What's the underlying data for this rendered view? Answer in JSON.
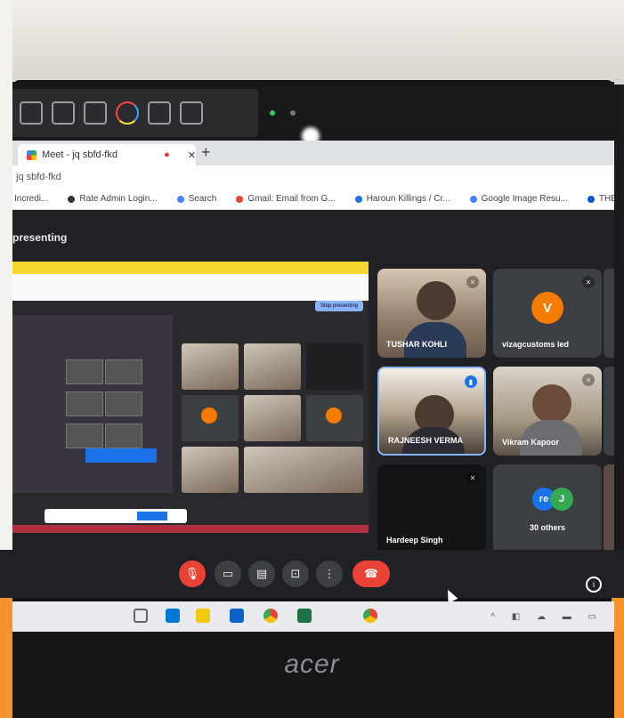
{
  "hardware_keys": [
    "display-icon",
    "sleep-icon",
    "backlight-icon",
    "color-icon",
    "audio-icon",
    "touchpad-icon"
  ],
  "browser": {
    "tab_title": "Meet - jq sbfd-fkd",
    "url": "jq sbfd-fkd",
    "bookmarks": [
      "Incredi...",
      "Rate Admin Login...",
      "Search",
      "Gmail: Email from G...",
      "Haroun Killings / Cr...",
      "Google Image Resu...",
      "THE STANDARD"
    ]
  },
  "meet": {
    "presenting_label": "presenting",
    "share_stop_label": "Stop presenting",
    "participants": [
      {
        "name": "TUSHAR KOHLI",
        "kind": "video",
        "mic": "muted"
      },
      {
        "name": "vizagcustoms led",
        "kind": "avatar",
        "initial": "V",
        "mic": "muted"
      },
      {
        "name": "RAJNEESH VERMA",
        "kind": "video",
        "mic": "speaking"
      },
      {
        "name": "Vikram Kapoor",
        "kind": "video",
        "mic": "muted"
      },
      {
        "name": "Hardeep Singh",
        "kind": "no-video",
        "mic": "muted"
      },
      {
        "name": "30 others",
        "kind": "others",
        "initials": [
          "re",
          "J"
        ]
      }
    ]
  },
  "controls": [
    "mic-off",
    "camera",
    "captions",
    "present",
    "more",
    "hang-up"
  ],
  "brand": "acer",
  "colors": {
    "meet_bg": "#202124",
    "tile_bg": "#3c4043",
    "hangup": "#ea4335",
    "avatar_orange": "#f57c00",
    "accent_blue": "#1a73e8",
    "frame_orange": "#f6932c"
  }
}
